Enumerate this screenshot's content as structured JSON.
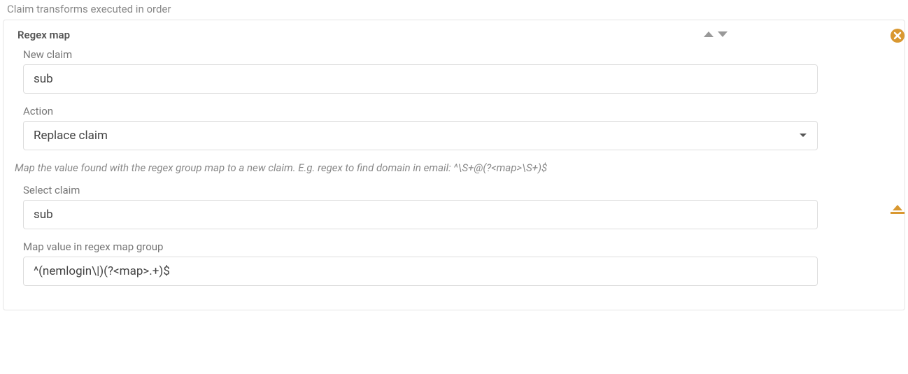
{
  "sectionLabel": "Claim transforms executed in order",
  "panel": {
    "title": "Regex map",
    "helpText": "Map the value found with the regex group map to a new claim. E.g. regex to find domain in email: ^\\S+@(?<map>\\S+)$",
    "fields": {
      "newClaim": {
        "label": "New claim",
        "value": "sub"
      },
      "action": {
        "label": "Action",
        "value": "Replace claim"
      },
      "selectClaim": {
        "label": "Select claim",
        "value": "sub"
      },
      "mapValue": {
        "label": "Map value in regex map group",
        "value": "^(nemlogin\\|)(?<map>.+)$"
      }
    }
  }
}
